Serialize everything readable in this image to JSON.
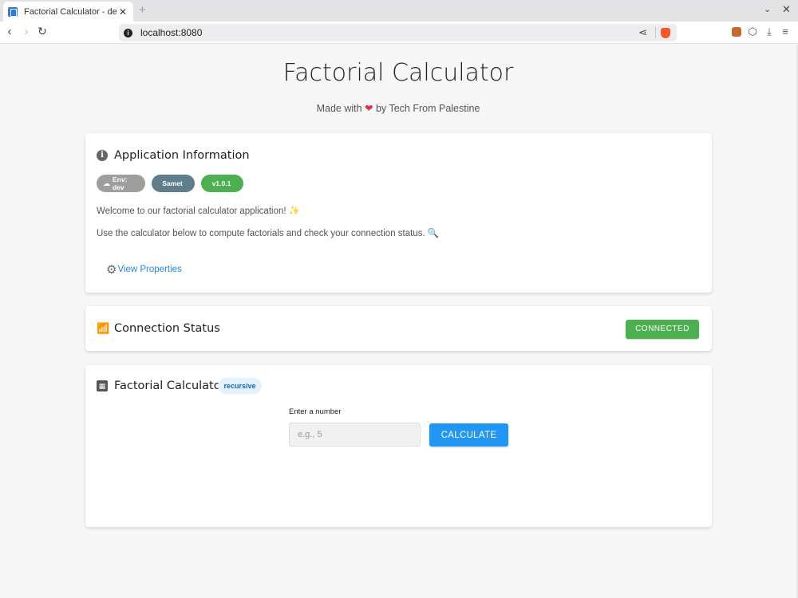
{
  "browser": {
    "tab_title": "Factorial Calculator - dev",
    "tab_close": "✕",
    "new_tab": "+",
    "url": "localhost:8080"
  },
  "page": {
    "title": "Factorial Calculator",
    "subtitle_prefix": "Made with",
    "subtitle_suffix": "by Tech From Palestine"
  },
  "app_info": {
    "title": "Application Information",
    "chips": {
      "env": "Env: dev",
      "user": "Samet",
      "version": "v1.0.1"
    },
    "welcome": "Welcome to our factorial calculator application!",
    "instructions": "Use the calculator below to compute factorials and check your connection status.",
    "view_properties": "View Properties"
  },
  "connection": {
    "title": "Connection Status",
    "status": "CONNECTED"
  },
  "calculator": {
    "title": "Factorial Calculator",
    "mode_badge": "recursive",
    "input_label": "Enter a number",
    "input_placeholder": "e.g., 5",
    "button_label": "CALCULATE"
  },
  "colors": {
    "connected": "#4caf50",
    "primary": "#2196f3",
    "link": "#1e88e5"
  }
}
